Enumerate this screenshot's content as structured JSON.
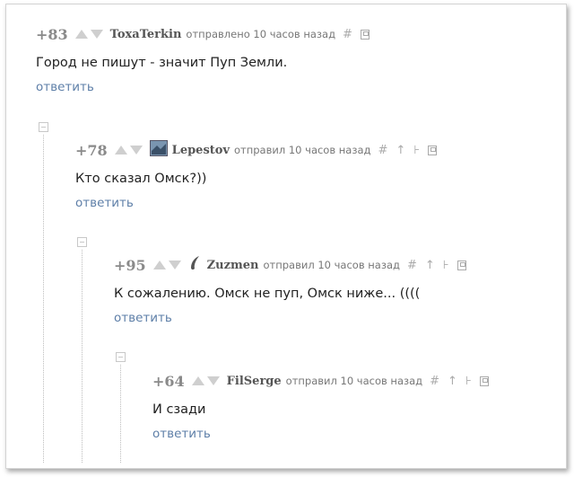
{
  "comments": [
    {
      "rating": "+83",
      "author": "ToxaTerkin",
      "meta": "отправлено 10 часов назад",
      "text": "Город не пишут - значит Пуп Земли.",
      "reply": "ответить"
    },
    {
      "rating": "+78",
      "author": "Lepestov",
      "meta": "отправил 10 часов назад",
      "text": "Кто сказал Омск?))",
      "reply": "ответить"
    },
    {
      "rating": "+95",
      "author": "Zuzmen",
      "meta": "отправил 10 часов назад",
      "text": "К сожалению. Омск не пуп, Омск ниже... ((((",
      "reply": "ответить"
    },
    {
      "rating": "+64",
      "author": "FilSerge",
      "meta": "отправил 10 часов назад",
      "text": "И сзади",
      "reply": "ответить"
    }
  ],
  "icons": {
    "hash": "#",
    "up_tree": "↑",
    "tree": "⊦"
  },
  "colors": {
    "reply_link": "#5e7fa8",
    "rating": "#8a8a8a",
    "meta": "#777777"
  }
}
